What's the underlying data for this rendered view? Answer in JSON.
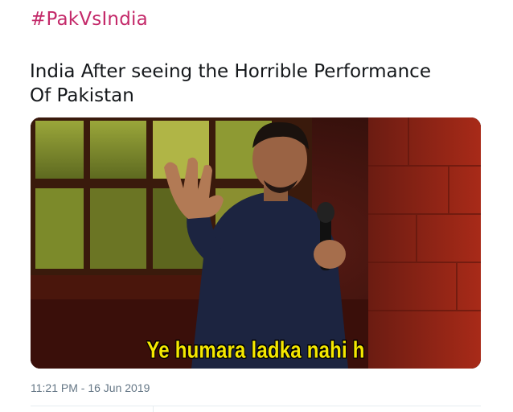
{
  "tweet": {
    "hashtag": "#PakVsIndia",
    "text": "India After seeing the Horrible Performance\nOf Pakistan",
    "media": {
      "caption": "Ye humara ladka nahi h"
    },
    "timestamp": "11:21 PM - 16 Jun 2019"
  },
  "colors": {
    "hashtag": "#c42a6a",
    "text": "#14171a",
    "timestamp": "#657786",
    "caption": "#f5e800"
  }
}
